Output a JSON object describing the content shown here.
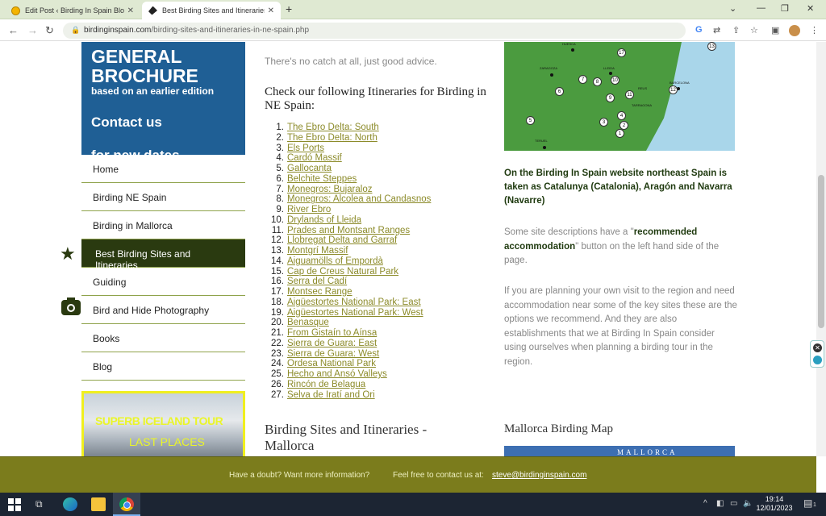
{
  "browser": {
    "tabs": [
      {
        "title": "Edit Post ‹ Birding In Spain Blog — ",
        "active": false
      },
      {
        "title": "Best Birding Sites and Itineraries",
        "active": true
      }
    ],
    "new_tab": "+",
    "url_host": "birdinginspain.com",
    "url_path": "/birding-sites-and-itineraries-in-ne-spain.php",
    "window_controls": [
      "⌄",
      "—",
      "❐",
      "✕"
    ]
  },
  "brochure": {
    "line1": "GENERAL",
    "line2": "BROCHURE",
    "line3": "based on an earlier edition",
    "line4": "Contact us",
    "line5": "for new dates"
  },
  "menu": [
    {
      "label": "Home"
    },
    {
      "label": "Birding NE Spain"
    },
    {
      "label": "Birding in Mallorca"
    },
    {
      "label": "Best Birding Sites and Itineraries",
      "active": true
    },
    {
      "label": "Guiding"
    },
    {
      "label": "Bird and Hide Photography"
    },
    {
      "label": "Books"
    },
    {
      "label": "Blog"
    }
  ],
  "iceland": {
    "line1": "SUPERB ICELAND TOUR",
    "line2": "LAST PLACES"
  },
  "intro": "There's no catch at all, just good advice.",
  "itinerary_heading": "Check our following Itineraries for Birding in NE Spain:",
  "itineraries": [
    "The Ebro Delta: South",
    "The Ebro Delta: North",
    "Els Ports",
    "Cardó Massif",
    "Gallocanta",
    "Belchite Steppes",
    "Monegros: Bujaraloz",
    "Monegros: Alcolea and Candasnos",
    "River Ebro",
    "Drylands of Lleida",
    "Prades and Montsant Ranges",
    "Llobregat Delta and Garraf",
    "Montgrí Massif",
    "Aiguamölls of Empordà",
    "Cap de Creus Natural Park",
    "Serra del Cadí",
    "Montsec Range",
    "Aigüestortes National Park: East",
    "Aigüestortes National Park: West",
    "Benasque",
    "From Gistaín to Aínsa",
    "Sierra de Guara: East",
    "Sierra de Guara: West",
    "Ordesa National Park",
    "Hecho and Ansó Valleys",
    "Rincón de Belagua",
    "Selva de Iratí and Ori"
  ],
  "mallorca_heading": "Birding Sites and Itineraries - Mallorca",
  "ne_description": "On the Birding In Spain website northeast Spain is taken as Catalunya (Catalonia), Aragón and Navarra (Navarre)",
  "accommodation": {
    "pre": "Some site descriptions have a \"",
    "bold": "recommended accommodation",
    "post": "\" button on the left hand side of the page."
  },
  "planning_text": "If you are planning your own visit to the region and need accommodation near some of the key sites these are the options we recommend. And they are also establishments that we at Birding In Spain consider using ourselves when planning a birding tour in the region.",
  "mallorca_map_heading": "Mallorca Birding Map",
  "mallorca_map_label": "MALLORCA",
  "map_labels": {
    "huesca": "HUESCA",
    "zaragoza": "ZARAGOZA",
    "lleida": "LLEIDA",
    "reus": "REUS",
    "barcelona": "BARCELONA",
    "tarragona": "TARRAGONA",
    "teruel": "TERUEL"
  },
  "footer": {
    "question": "Have a doubt? Want more information?",
    "contact": "Feel free to contact us at:",
    "email": "steve@birdinginspain.com"
  },
  "taskbar": {
    "time": "19:14",
    "date": "12/01/2023",
    "notification_count": "1"
  }
}
